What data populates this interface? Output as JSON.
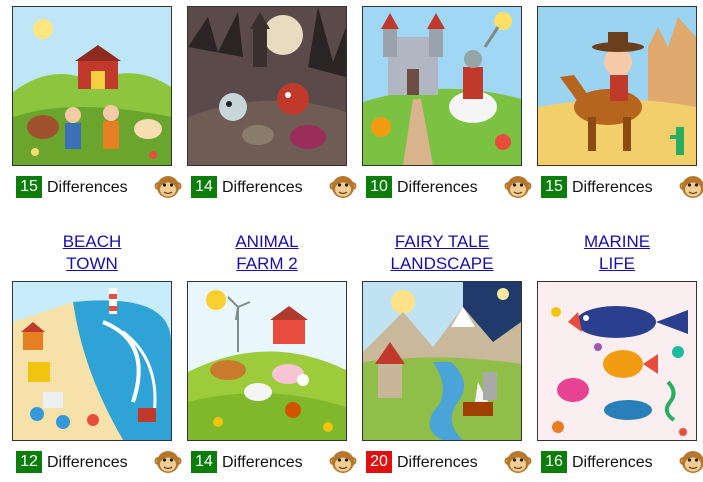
{
  "cards": [
    {
      "count": "15",
      "count_color": "#0a7d0a",
      "label": "Differences"
    },
    {
      "count": "14",
      "count_color": "#0a7d0a",
      "label": "Differences"
    },
    {
      "count": "10",
      "count_color": "#0a7d0a",
      "label": "Differences"
    },
    {
      "count": "15",
      "count_color": "#0a7d0a",
      "label": "Differences"
    },
    {
      "count": "12",
      "count_color": "#0a7d0a",
      "label": "Differences",
      "title1": "BEACH",
      "title2": "TOWN"
    },
    {
      "count": "14",
      "count_color": "#0a7d0a",
      "label": "Differences",
      "title1": "ANIMAL",
      "title2": "FARM 2"
    },
    {
      "count": "20",
      "count_color": "#e01010",
      "label": "Differences",
      "title1": "FAIRY TALE",
      "title2": "LANDSCAPE"
    },
    {
      "count": "16",
      "count_color": "#0a7d0a",
      "label": "Differences",
      "title1": "MARINE",
      "title2": "LIFE"
    }
  ],
  "icons": {
    "monkey": "monkey-icon"
  }
}
